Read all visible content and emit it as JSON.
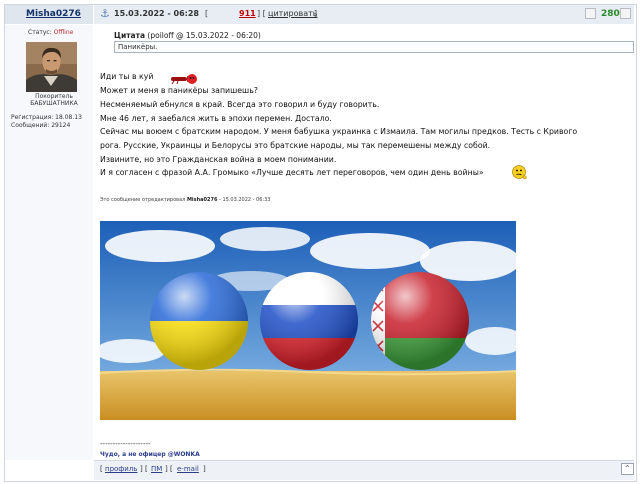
{
  "header": {
    "username": "Misha0276",
    "date": "15.03.2022 - 06:28",
    "post_number": "911",
    "quote_label": "цитировать",
    "rating": "280"
  },
  "user": {
    "status_label": "Статус:",
    "status_value": "Offline",
    "title_line1": "Покоритель",
    "title_line2": "БАБУШАТНИКА",
    "registration": "Регистрация: 18.08.13",
    "messages": "Сообщений: 29124"
  },
  "quote": {
    "title_word": "Цитата",
    "title_meta": "(poiloff @ 15.03.2022 - 06:20)",
    "text": "Паникёры."
  },
  "post": {
    "lines": [
      "Иди ты в куй",
      "Может и меня в паникёры запишешь?",
      "Несменяемый ебнулся в край. Всегда это говорил и буду говорить.",
      "Мне 46 лет, я заебался жить в эпохи перемен. Достало.",
      "Сейчас мы воюем с братским народом. У меня бабушка украинка с Измаила. Там могилы предков. Тесть с Кривого",
      "рога. Русские, Украинцы и Белорусы это братские народы, мы так перемешены между собой.",
      "Извините, но это Гражданская война в моем понимании.",
      "И я согласен с фразой А.А. Громыко «Лучше десять лет переговоров, чем один день войны»"
    ],
    "edited_prefix": "Это сообщение отредактировал",
    "edited_user": "Misha0276",
    "edited_date": "- 15.03.2022 - 06:33"
  },
  "signature": {
    "dashes": "--------------------",
    "text": "Чудо, а не офицер @WONKA"
  },
  "footer": {
    "profile": "профиль",
    "pm": "ПМ",
    "email": "e-mail",
    "up": "^"
  }
}
